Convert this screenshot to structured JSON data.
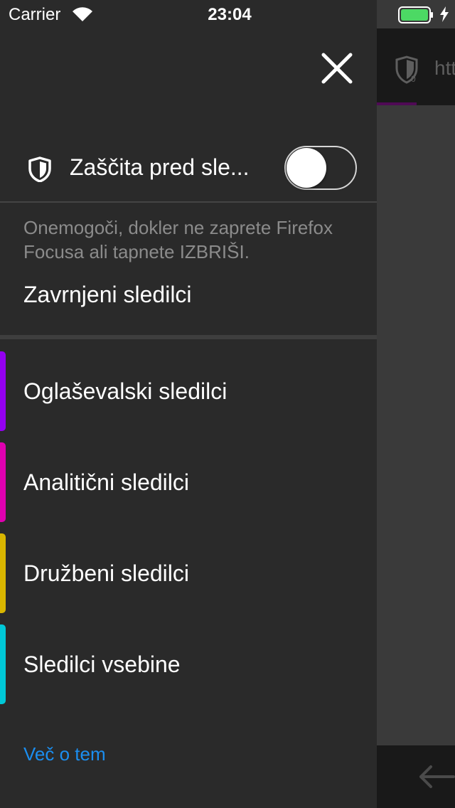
{
  "status_bar": {
    "carrier": "Carrier",
    "time": "23:04",
    "battery_color": "#4cd964"
  },
  "background": {
    "url_partial": "htt",
    "shield_badge": "0",
    "progress_color": "#4f0a55"
  },
  "panel": {
    "close_icon": "close-icon",
    "tracking_protection": {
      "label": "Zaščita pred sle...",
      "enabled": false,
      "description": "Onemogoči, dokler ne zaprete Firefox Focusa ali tapnete IZBRIŠI."
    },
    "blocked_title": "Zavrnjeni sledilci",
    "categories": [
      {
        "label": "Oglaševalski sledilci",
        "color": "#9400f0"
      },
      {
        "label": "Analitični sledilci",
        "color": "#e000b0"
      },
      {
        "label": "Družbeni sledilci",
        "color": "#d9b600"
      },
      {
        "label": "Sledilci vsebine",
        "color": "#00c8d7"
      }
    ],
    "learn_more": "Več o tem",
    "link_color": "#1b8ef0"
  }
}
